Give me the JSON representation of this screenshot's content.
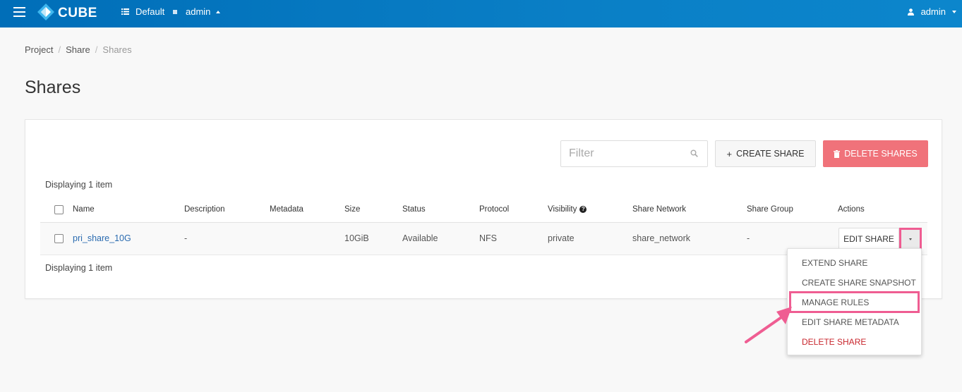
{
  "topbar": {
    "brand": "CUBE",
    "domain": "Default",
    "project": "admin",
    "user": "admin"
  },
  "breadcrumb": [
    "Project",
    "Share",
    "Shares"
  ],
  "page_title": "Shares",
  "toolbar": {
    "filter_placeholder": "Filter",
    "create_label": "CREATE SHARE",
    "delete_label": "DELETE SHARES"
  },
  "table": {
    "count_text": "Displaying 1 item",
    "columns": [
      "Name",
      "Description",
      "Metadata",
      "Size",
      "Status",
      "Protocol",
      "Visibility",
      "Share Network",
      "Share Group",
      "Actions"
    ],
    "rows": [
      {
        "name": "pri_share_10G",
        "description": "-",
        "metadata": "",
        "size": "10GiB",
        "status": "Available",
        "protocol": "NFS",
        "visibility": "private",
        "share_network": "share_network",
        "share_group": "-",
        "action_label": "EDIT SHARE"
      }
    ]
  },
  "action_menu": {
    "items": [
      "EXTEND SHARE",
      "CREATE SHARE SNAPSHOT",
      "MANAGE RULES",
      "EDIT SHARE METADATA",
      "DELETE SHARE"
    ],
    "highlighted": "MANAGE RULES"
  },
  "colors": {
    "topbar": "#0a7fc6",
    "danger_button": "#f0727a",
    "annotation": "#ef5d92",
    "link": "#2a6bb0"
  }
}
